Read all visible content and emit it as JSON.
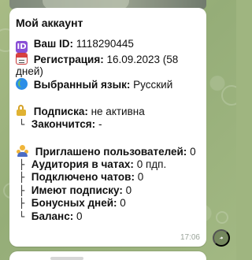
{
  "message": {
    "title": "Мой аккаунт",
    "id_label": "Ваш ID:",
    "id_value": "1118290445",
    "registration_label": "Регистрация:",
    "registration_value": "16.09.2023 (58",
    "registration_value_continuation": "дней)",
    "language_label": "Выбранный язык:",
    "language_value": "Русский",
    "subscription_label": "Подписка:",
    "subscription_value": "не активна",
    "ends_label": "Закончится:",
    "ends_value": "-",
    "invited_label": "Приглашено пользователей:",
    "invited_value": "0",
    "audience_label": "Аудитория в чатах:",
    "audience_value": "0 пдп.",
    "connected_label": "Подключено чатов:",
    "connected_value": "0",
    "have_subscription_label": "Имеют подписку:",
    "have_subscription_value": "0",
    "bonus_days_label": "Бонусных дней:",
    "bonus_days_value": "0",
    "balance_label": "Баланс:",
    "balance_value": "0",
    "time": "17:06"
  },
  "icons": {
    "id": "id-icon",
    "registration": "calendar-icon",
    "language": "globe-icon",
    "subscription": "lock-icon",
    "invited": "people-icon",
    "forward": "forward-icon"
  },
  "colors": {
    "chat_background": "#9fb580",
    "bubble_background": "#ffffff",
    "timestamp": "#9aa49a",
    "id_icon": "#8a4fd6",
    "calendar_icon": "#d84040",
    "globe_icon": "#2d8ee7",
    "lock_icon": "#d5a229",
    "people_icon": "#f0b53a"
  }
}
